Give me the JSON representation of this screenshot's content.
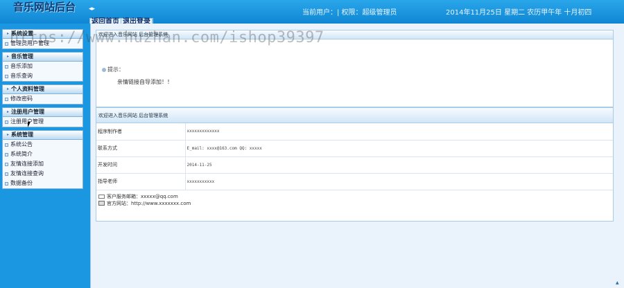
{
  "header": {
    "logo_text": "音乐网站后台",
    "collapse_icon": "◂▸",
    "user_info": "当前用户：| 权限：超级管理员",
    "date_info": "2014年11月25日 星期二 农历甲午年 十月初四"
  },
  "topnav": {
    "home": "返回首页",
    "logout": "退出登录"
  },
  "sidebar": {
    "groups": [
      {
        "title": "系统设置",
        "items": [
          "管理员用户管理"
        ]
      },
      {
        "title": "音乐管理",
        "items": [
          "音乐添加",
          "音乐查询"
        ]
      },
      {
        "title": "个人资料管理",
        "items": [
          "修改密码"
        ]
      },
      {
        "title": "注册用户管理",
        "items": [
          "注册用户管理"
        ]
      },
      {
        "title": "系统管理",
        "items": [
          "系统公告",
          "系统简介",
          "友情连接添加",
          "友情连接查询",
          "数据备份"
        ]
      }
    ]
  },
  "panel1": {
    "title": "欢迎进入音乐网站 后台管理系统",
    "tip_label": "提示：",
    "tip_text": "亲情链接自导添加！！"
  },
  "panel2": {
    "title": "欢迎进入音乐网站 后台管理系统",
    "rows": [
      {
        "key": "程序制作者",
        "value": "xxxxxxxxxxxxx"
      },
      {
        "key": "联系方式",
        "value": "E_mail: xxxx@163.com QQ: xxxxx"
      },
      {
        "key": "开发时间",
        "value": "2014-11-25"
      },
      {
        "key": "指导老师",
        "value": "xxxxxxxxxxx"
      }
    ],
    "service_email": "客户服务邮箱：xxxxx@qq.com",
    "website": "官方网站：http://www.xxxxxxx.com"
  },
  "watermark": "https://www.huzhan.com/ishop39397",
  "icons": {
    "menu_tri": "triangle-icon",
    "bullet": "square-bullet-icon"
  },
  "colors": {
    "sidebar_bg": "#1a97e0",
    "header_bg": "#0f86d3",
    "main_bg": "#eaf3fb"
  }
}
